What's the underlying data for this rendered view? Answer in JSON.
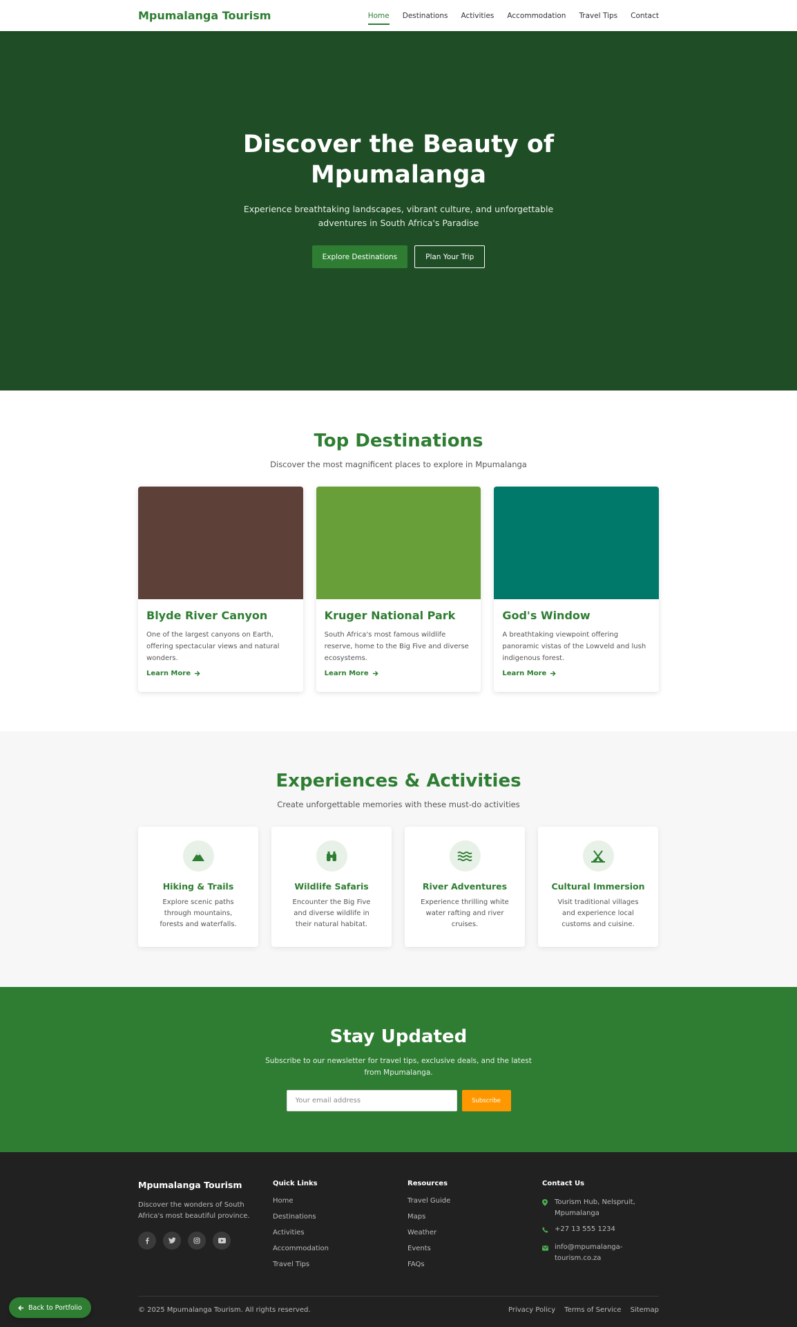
{
  "brand": "Mpumalanga Tourism",
  "nav": {
    "items": [
      "Home",
      "Destinations",
      "Activities",
      "Accommodation",
      "Travel Tips",
      "Contact"
    ],
    "active": "Home"
  },
  "hero": {
    "title": "Discover the Beauty of Mpumalanga",
    "subtitle": "Experience breathtaking landscapes, vibrant culture, and unforgettable adventures in South Africa's Paradise",
    "primary_button": "Explore Destinations",
    "secondary_button": "Plan Your Trip"
  },
  "destinations": {
    "title": "Top Destinations",
    "subtitle": "Discover the most magnificent places to explore in Mpumalanga",
    "learn_more_label": "Learn More",
    "cards": [
      {
        "title": "Blyde River Canyon",
        "description": "One of the largest canyons on Earth, offering spectacular views and natural wonders.",
        "image_color": "#5d4037"
      },
      {
        "title": "Kruger National Park",
        "description": "South Africa's most famous wildlife reserve, home to the Big Five and diverse ecosystems.",
        "image_color": "#689f38"
      },
      {
        "title": "God's Window",
        "description": "A breathtaking viewpoint offering panoramic vistas of the Lowveld and lush indigenous forest.",
        "image_color": "#00796b"
      }
    ]
  },
  "activities": {
    "title": "Experiences & Activities",
    "subtitle": "Create unforgettable memories with these must-do activities",
    "cards": [
      {
        "icon": "mountain-icon",
        "title": "Hiking & Trails",
        "description": "Explore scenic paths through mountains, forests and waterfalls."
      },
      {
        "icon": "binoculars-icon",
        "title": "Wildlife Safaris",
        "description": "Encounter the Big Five and diverse wildlife in their natural habitat."
      },
      {
        "icon": "water-icon",
        "title": "River Adventures",
        "description": "Experience thrilling white water rafting and river cruises."
      },
      {
        "icon": "campground-icon",
        "title": "Cultural Immersion",
        "description": "Visit traditional villages and experience local customs and cuisine."
      }
    ]
  },
  "newsletter": {
    "title": "Stay Updated",
    "text": "Subscribe to our newsletter for travel tips, exclusive deals, and the latest from Mpumalanga.",
    "email_placeholder": "Your email address",
    "button": "Subscribe"
  },
  "footer": {
    "brand": "Mpumalanga Tourism",
    "about": "Discover the wonders of South Africa's most beautiful province.",
    "socials": [
      "facebook-icon",
      "twitter-icon",
      "instagram-icon",
      "youtube-icon"
    ],
    "quick_links": {
      "title": "Quick Links",
      "items": [
        "Home",
        "Destinations",
        "Activities",
        "Accommodation",
        "Travel Tips"
      ]
    },
    "resources": {
      "title": "Resources",
      "items": [
        "Travel Guide",
        "Maps",
        "Weather",
        "Events",
        "FAQs"
      ]
    },
    "contact": {
      "title": "Contact Us",
      "address": "Tourism Hub, Nelspruit, Mpumalanga",
      "phone": "+27 13 555 1234",
      "email": "info@mpumalanga-tourism.co.za"
    },
    "copyright": "© 2025 Mpumalanga Tourism. All rights reserved.",
    "legal": [
      "Privacy Policy",
      "Terms of Service",
      "Sitemap"
    ]
  },
  "back_button": "Back to Portfolio",
  "colors": {
    "primary": "#2e7d32",
    "hero_bg": "#1f4d25",
    "accent": "#ff9800",
    "footer_bg": "#212121"
  }
}
